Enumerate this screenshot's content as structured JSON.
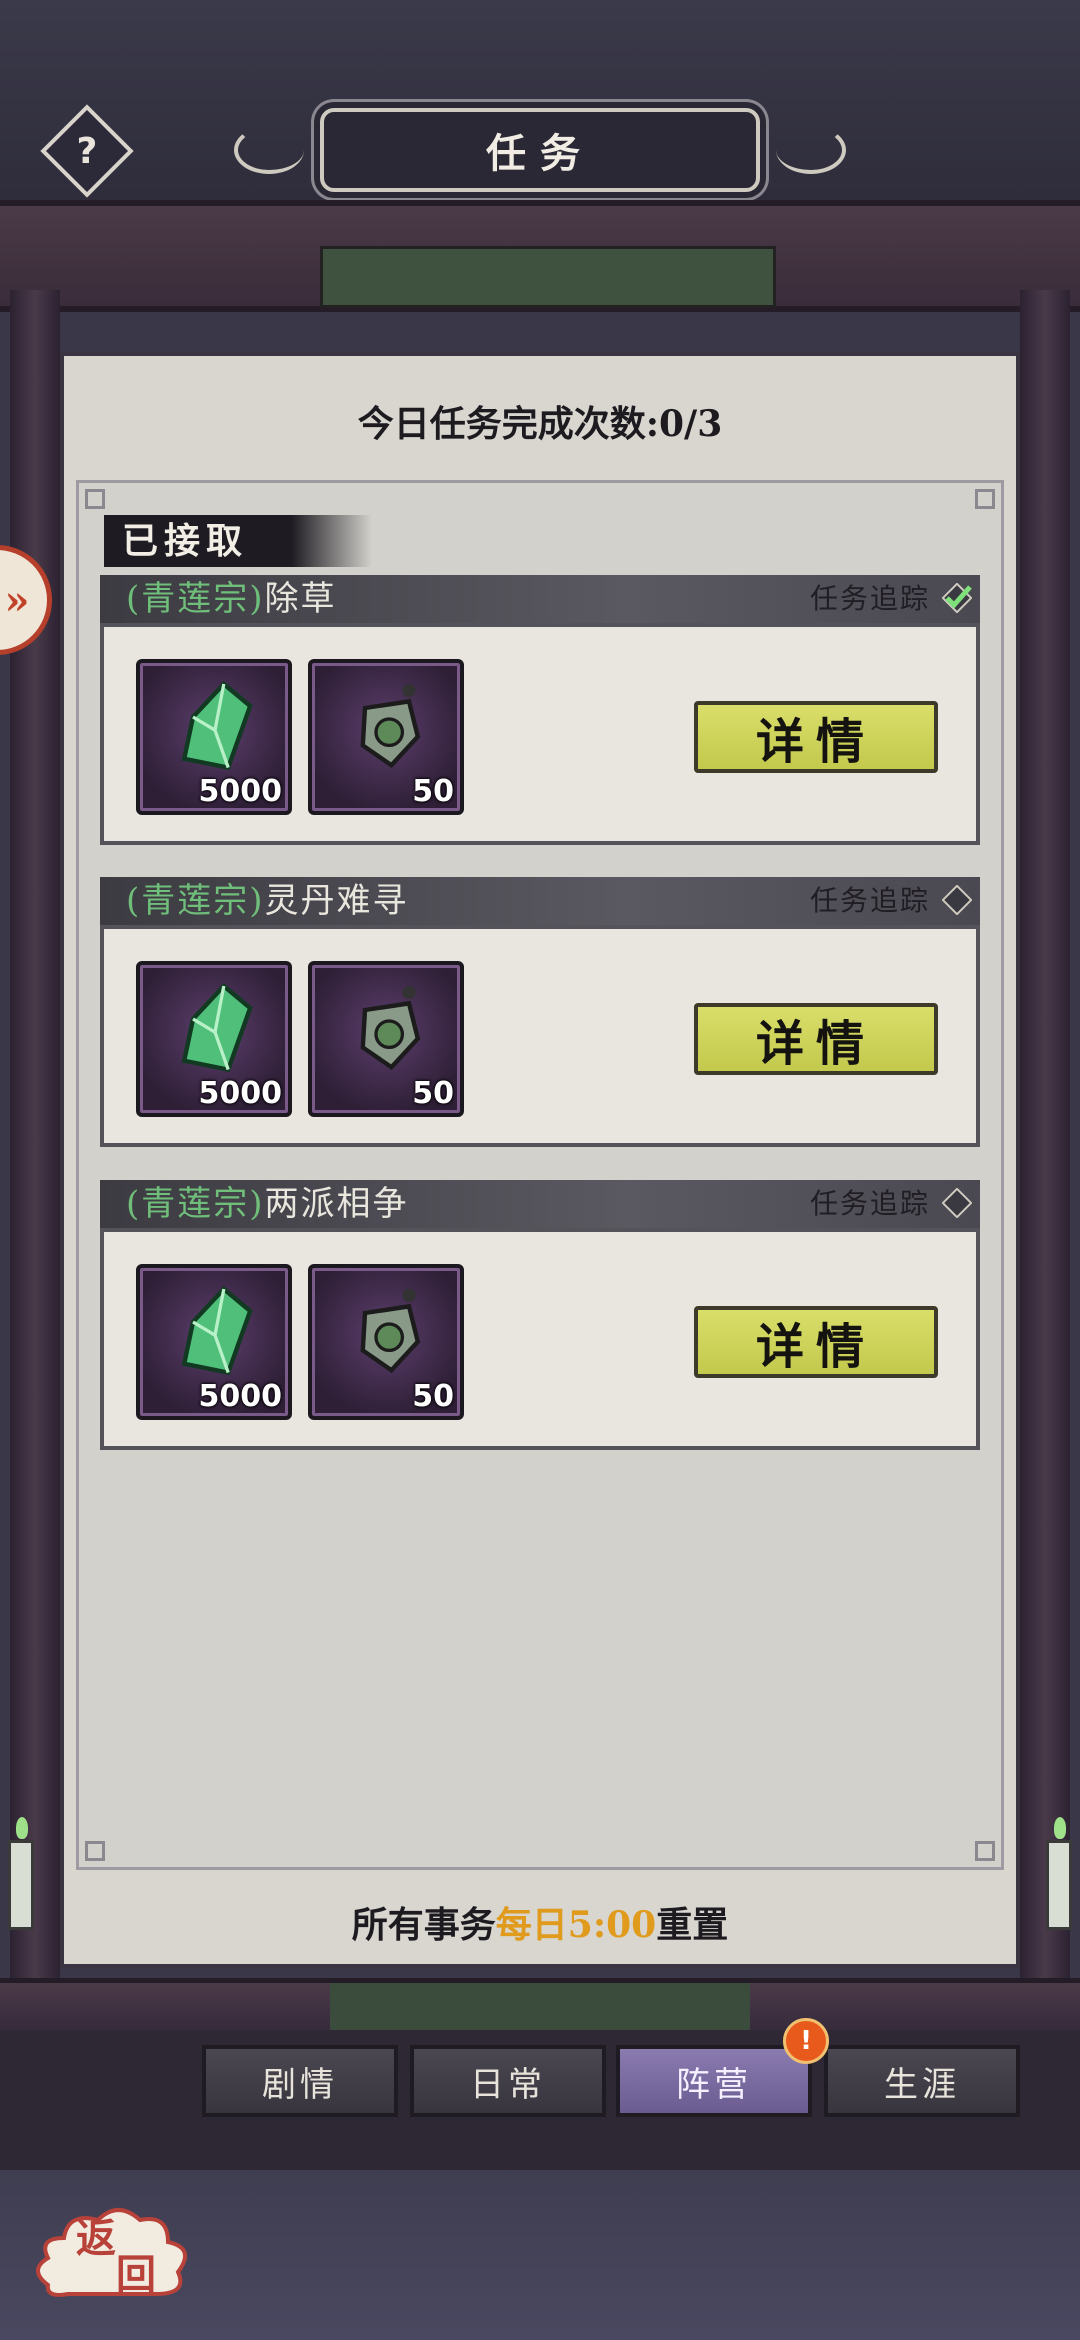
{
  "header": {
    "title": "任务",
    "help_label": "?"
  },
  "side_tab": {
    "label": "»"
  },
  "daily": {
    "text": "今日任务完成次数:0/3"
  },
  "accepted_label": "已接取",
  "tasks": [
    {
      "sect": "(青莲宗)",
      "name": "除草",
      "track_label": "任务追踪",
      "tracked": true,
      "rewards": [
        {
          "icon": "jade-crystal-icon",
          "amount": "5000"
        },
        {
          "icon": "amulet-icon",
          "amount": "50"
        }
      ],
      "detail_label": "详情"
    },
    {
      "sect": "(青莲宗)",
      "name": "灵丹难寻",
      "track_label": "任务追踪",
      "tracked": false,
      "rewards": [
        {
          "icon": "jade-crystal-icon",
          "amount": "5000"
        },
        {
          "icon": "amulet-icon",
          "amount": "50"
        }
      ],
      "detail_label": "详情"
    },
    {
      "sect": "(青莲宗)",
      "name": "两派相争",
      "track_label": "任务追踪",
      "tracked": false,
      "rewards": [
        {
          "icon": "jade-crystal-icon",
          "amount": "5000"
        },
        {
          "icon": "amulet-icon",
          "amount": "50"
        }
      ],
      "detail_label": "详情"
    }
  ],
  "reset": {
    "prefix": "所有事务",
    "highlight": "每日5:00",
    "suffix": "重置"
  },
  "tabs": [
    {
      "label": "剧情",
      "active": false
    },
    {
      "label": "日常",
      "active": false
    },
    {
      "label": "阵营",
      "active": true,
      "badge": "!"
    },
    {
      "label": "生涯",
      "active": false
    }
  ],
  "back": {
    "label_top": "返",
    "label_bottom": "回"
  },
  "colors": {
    "sect_green": "#6fbf7a",
    "detail_button": "#c3c94c",
    "active_tab": "#7a6ca0",
    "reset_highlight": "#e09a1c"
  }
}
